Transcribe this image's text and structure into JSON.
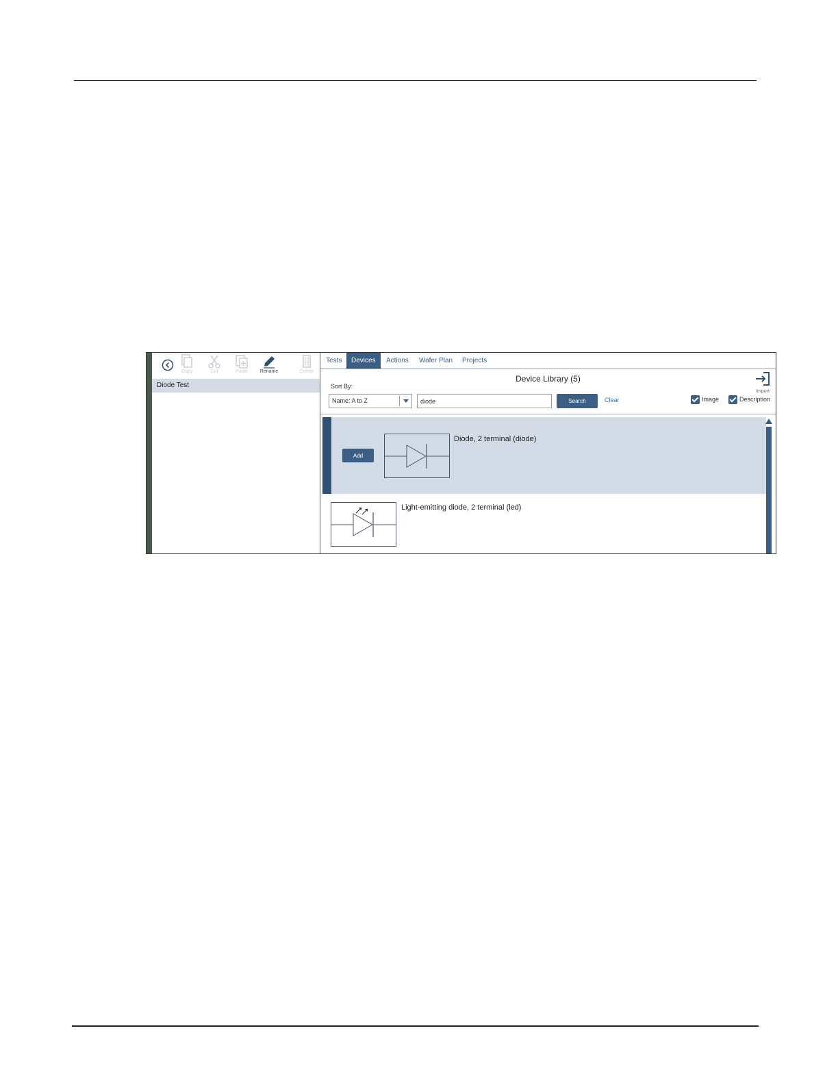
{
  "toolbar": {
    "copy_label": "Copy",
    "cut_label": "Cut",
    "paste_label": "Paste",
    "rename_label": "Rename",
    "delete_label": "Delete"
  },
  "tree": {
    "selected_item": "Diode Test"
  },
  "tabs": [
    {
      "label": "Tests"
    },
    {
      "label": "Devices"
    },
    {
      "label": "Actions"
    },
    {
      "label": "Wafer Plan"
    },
    {
      "label": "Projects"
    }
  ],
  "library": {
    "title": "Device Library (5)",
    "import_label": "Import",
    "sort_by_label": "Sort By:",
    "sort_value": "Name: A to Z",
    "search_value": "diode",
    "search_button": "Search",
    "clear_link": "Clear",
    "image_checkbox": "Image",
    "description_checkbox": "Description"
  },
  "devices": [
    {
      "name": "Diode, 2 terminal (diode)",
      "add_label": "Add"
    },
    {
      "name": "Light-emitting diode, 2 terminal (led)"
    }
  ],
  "colors": {
    "accent": "#3b5e84",
    "selected_row": "#d3dce6",
    "link": "#3b73b0"
  }
}
